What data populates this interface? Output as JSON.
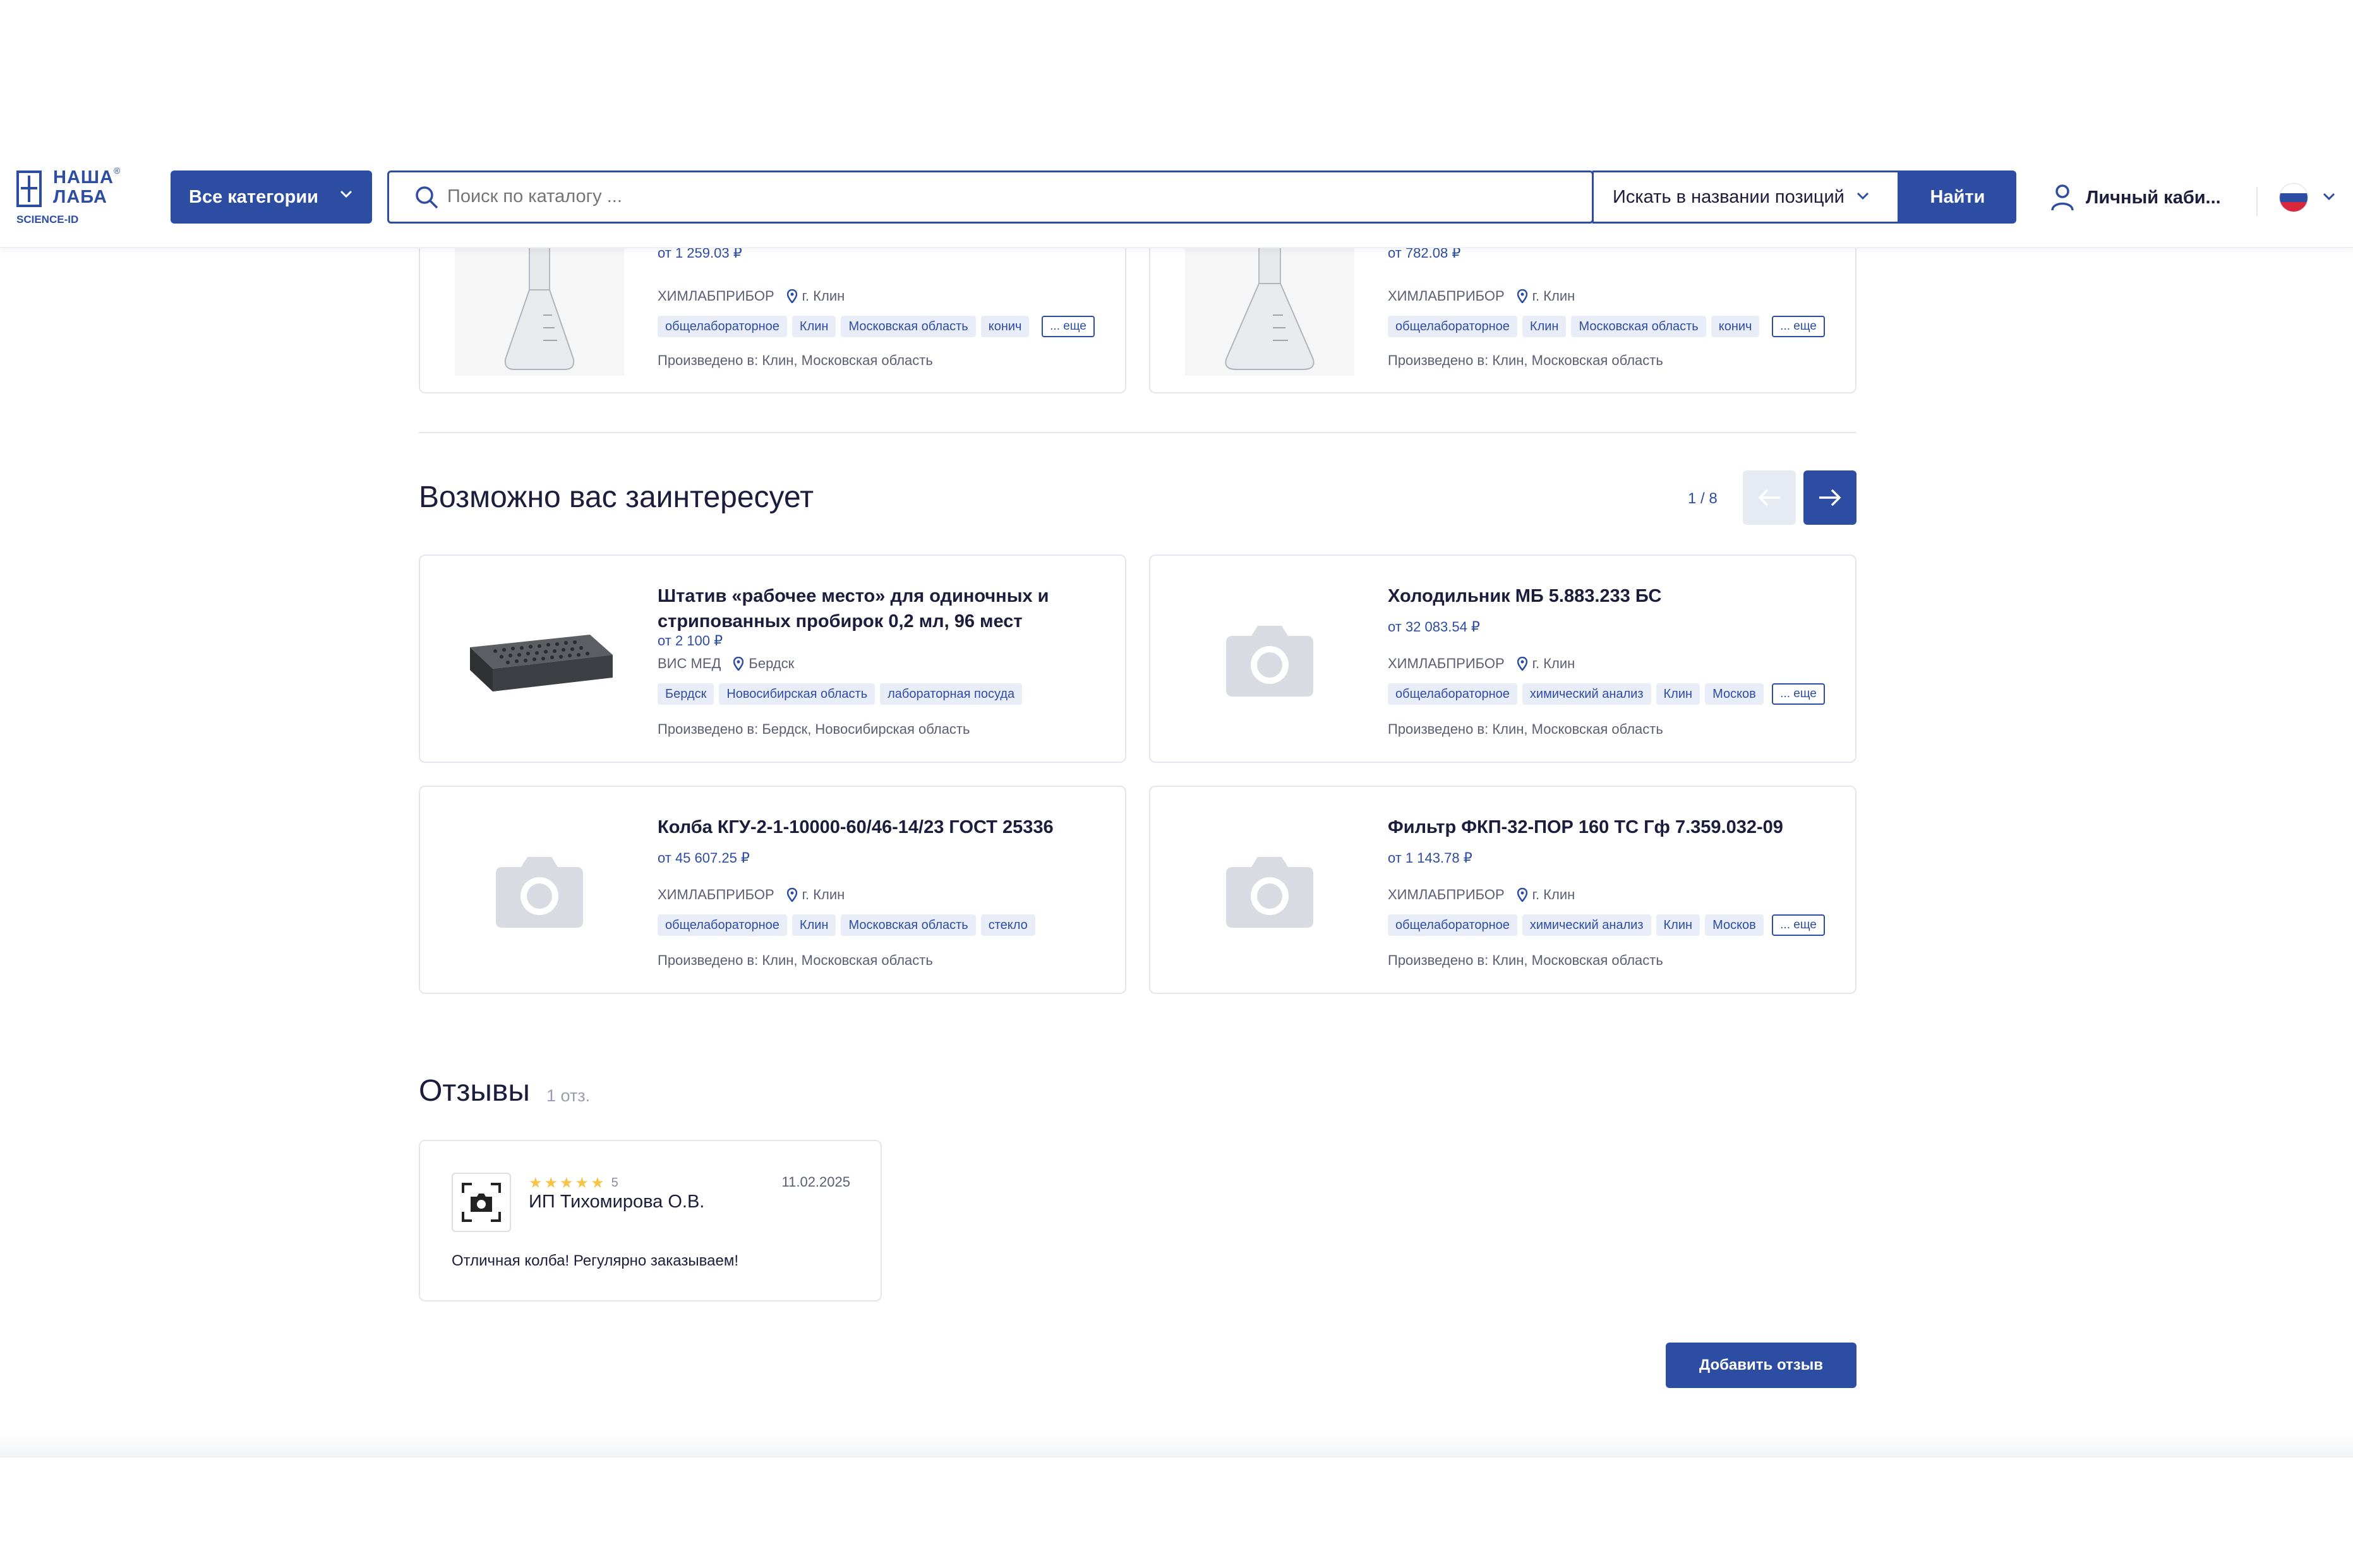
{
  "header": {
    "logo_line1": "НАША",
    "logo_line2": "ЛАБА",
    "logo_reg": "®",
    "logo_sub": "SCIENCE-ID",
    "categories_label": "Все категории",
    "search_placeholder": "Поиск по каталогу ...",
    "search_mode": "Искать в названии позиций",
    "find_label": "Найти",
    "account_label": "Личный каби..."
  },
  "top_cards": [
    {
      "price": "от 1 259.03 ₽",
      "supplier": "ХИМЛАБПРИБОР",
      "city": "г. Клин",
      "tags": [
        "общелабораторное",
        "Клин",
        "Московская область",
        "конич"
      ],
      "more": "... еще",
      "origin": "Произведено в: Клин, Московская область"
    },
    {
      "price": "от 782.08 ₽",
      "supplier": "ХИМЛАБПРИБОР",
      "city": "г. Клин",
      "tags": [
        "общелабораторное",
        "Клин",
        "Московская область",
        "конич"
      ],
      "more": "... еще",
      "origin": "Произведено в: Клин, Московская область"
    }
  ],
  "recommendations": {
    "title": "Возможно вас заинтересует",
    "pager": "1 / 8",
    "items": [
      {
        "title": "Штатив «рабочее место» для одиночных и стрипованных пробирок 0,2 мл, 96 мест",
        "price": "от 2 100 ₽",
        "supplier": "ВИС МЕД",
        "city": "Бердск",
        "tags": [
          "Бердск",
          "Новосибирская область",
          "лабораторная посуда"
        ],
        "more": "",
        "origin": "Произведено в: Бердск, Новосибирская область"
      },
      {
        "title": "Холодильник МБ 5.883.233 БС",
        "price": "от 32 083.54 ₽",
        "supplier": "ХИМЛАБПРИБОР",
        "city": "г. Клин",
        "tags": [
          "общелабораторное",
          "химический анализ",
          "Клин",
          "Москов"
        ],
        "more": "... еще",
        "origin": "Произведено в: Клин, Московская область"
      },
      {
        "title": "Колба КГУ-2-1-10000-60/46-14/23 ГОСТ 25336",
        "price": "от 45 607.25 ₽",
        "supplier": "ХИМЛАБПРИБОР",
        "city": "г. Клин",
        "tags": [
          "общелабораторное",
          "Клин",
          "Московская область",
          "стекло"
        ],
        "more": "",
        "origin": "Произведено в: Клин, Московская область"
      },
      {
        "title": "Фильтр ФКП-32-ПОР 160 ТС Гф 7.359.032-09",
        "price": "от 1 143.78 ₽",
        "supplier": "ХИМЛАБПРИБОР",
        "city": "г. Клин",
        "tags": [
          "общелабораторное",
          "химический анализ",
          "Клин",
          "Москов"
        ],
        "more": "... еще",
        "origin": "Произведено в: Клин, Московская область"
      }
    ]
  },
  "reviews": {
    "title": "Отзывы",
    "count": "1 отз.",
    "items": [
      {
        "author": "ИП Тихомирова О.В.",
        "rating": 5,
        "rating_label": "5",
        "date": "11.02.2025",
        "text": "Отличная колба! Регулярно заказываем!"
      }
    ],
    "add_label": "Добавить отзыв"
  },
  "colors": {
    "accent": "#2d4da3",
    "tag_bg": "#e9edf8",
    "star": "#f5c54a",
    "text": "#1b1d3c",
    "muted": "#5a5f73"
  },
  "icons": {
    "search": "search-icon",
    "chevron": "chevron-down-icon",
    "user": "user-icon",
    "flag": "russia-flag-icon",
    "location": "location-pin-icon",
    "arrow_left": "arrow-left-icon",
    "arrow_right": "arrow-right-icon",
    "camera": "camera-placeholder-icon"
  }
}
